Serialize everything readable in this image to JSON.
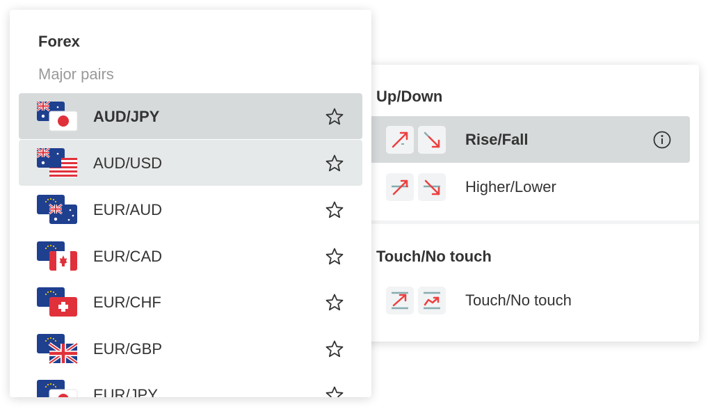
{
  "colors": {
    "loss_red": "#ec3f3f",
    "barrier_teal": "#85acb0",
    "row_active": "#d6dadb",
    "row_hover": "#e6e9e9",
    "icon_bg": "#f2f3f4"
  },
  "forex": {
    "title": "Forex",
    "submarket": "Major pairs",
    "symbols": [
      {
        "label": "AUD/JPY",
        "flags": [
          "australia-flag",
          "japan-flag"
        ],
        "favorite_icon": "star-icon"
      },
      {
        "label": "AUD/USD",
        "flags": [
          "australia-flag",
          "usa-flag"
        ],
        "favorite_icon": "star-icon"
      },
      {
        "label": "EUR/AUD",
        "flags": [
          "eu-flag",
          "australia-flag"
        ],
        "favorite_icon": "star-icon"
      },
      {
        "label": "EUR/CAD",
        "flags": [
          "eu-flag",
          "canada-flag"
        ],
        "favorite_icon": "star-icon"
      },
      {
        "label": "EUR/CHF",
        "flags": [
          "eu-flag",
          "switzerland-flag"
        ],
        "favorite_icon": "star-icon"
      },
      {
        "label": "EUR/GBP",
        "flags": [
          "eu-flag",
          "uk-flag"
        ],
        "favorite_icon": "star-icon"
      },
      {
        "label": "EUR/JPY",
        "flags": [
          "eu-flag",
          "japan-flag"
        ],
        "favorite_icon": "star-icon"
      }
    ]
  },
  "contract_types": {
    "up_down": {
      "title": "Up/Down",
      "items": [
        {
          "label": "Rise/Fall",
          "icons": [
            "rise-icon",
            "fall-icon"
          ],
          "info_icon": "info-icon"
        },
        {
          "label": "Higher/Lower",
          "icons": [
            "higher-icon",
            "lower-icon"
          ]
        }
      ]
    },
    "touch": {
      "title": "Touch/No touch",
      "items": [
        {
          "label": "Touch/No touch",
          "icons": [
            "touch-icon",
            "no-touch-icon"
          ]
        }
      ]
    }
  }
}
